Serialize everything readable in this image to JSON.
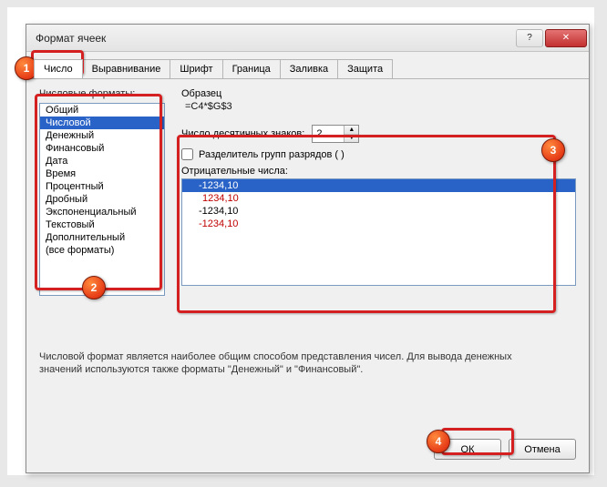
{
  "window": {
    "title": "Формат ячеек"
  },
  "tabs": {
    "items": [
      {
        "label": "Число",
        "active": true
      },
      {
        "label": "Выравнивание"
      },
      {
        "label": "Шрифт"
      },
      {
        "label": "Граница"
      },
      {
        "label": "Заливка"
      },
      {
        "label": "Защита"
      }
    ]
  },
  "labels": {
    "formats": "Числовые форматы:",
    "sample": "Образец",
    "decimals": "Число десятичных знаков:",
    "thousands": "Разделитель групп разрядов ( )",
    "negatives": "Отрицательные числа:"
  },
  "format_list": {
    "items": [
      {
        "label": "Общий"
      },
      {
        "label": "Числовой",
        "selected": true
      },
      {
        "label": "Денежный"
      },
      {
        "label": "Финансовый"
      },
      {
        "label": "Дата"
      },
      {
        "label": "Время"
      },
      {
        "label": "Процентный"
      },
      {
        "label": "Дробный"
      },
      {
        "label": "Экспоненциальный"
      },
      {
        "label": "Текстовый"
      },
      {
        "label": "Дополнительный"
      },
      {
        "label": "(все форматы)"
      }
    ]
  },
  "sample_value": "=C4*$G$3",
  "decimals_value": "2",
  "thousands_checked": false,
  "negative_list": {
    "items": [
      {
        "label": "-1234,10",
        "color": "#ffffff",
        "selected": true,
        "base_color": "#c00000"
      },
      {
        "label": "1234,10",
        "color": "#c00000"
      },
      {
        "label": "-1234,10",
        "color": "#000000"
      },
      {
        "label": "-1234,10",
        "color": "#c00000"
      }
    ]
  },
  "description": "Числовой формат является наиболее общим способом представления чисел. Для вывода денежных значений используются также форматы \"Денежный\" и \"Финансовый\".",
  "buttons": {
    "ok": "ОК",
    "cancel": "Отмена"
  },
  "callouts": {
    "1": "1",
    "2": "2",
    "3": "3",
    "4": "4"
  }
}
